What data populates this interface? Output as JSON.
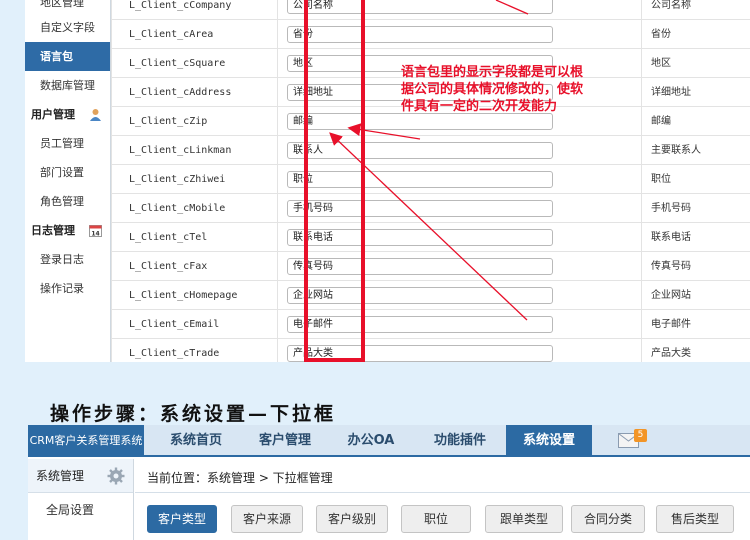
{
  "sidebar": {
    "cut_item": "地区管理",
    "items": [
      {
        "label": "自定义字段",
        "type": "item"
      },
      {
        "label": "语言包",
        "type": "active"
      },
      {
        "label": "数据库管理",
        "type": "item"
      },
      {
        "label": "用户管理",
        "type": "head"
      },
      {
        "label": "员工管理",
        "type": "item"
      },
      {
        "label": "部门设置",
        "type": "item"
      },
      {
        "label": "角色管理",
        "type": "item"
      },
      {
        "label": "日志管理",
        "type": "head"
      },
      {
        "label": "登录日志",
        "type": "item"
      },
      {
        "label": "操作记录",
        "type": "item"
      }
    ]
  },
  "fields": [
    {
      "name": "L_Client_cCompany",
      "value": "公司名称",
      "desc": "公司名称"
    },
    {
      "name": "L_Client_cArea",
      "value": "省份",
      "desc": "省份"
    },
    {
      "name": "L_Client_cSquare",
      "value": "地区",
      "desc": "地区"
    },
    {
      "name": "L_Client_cAddress",
      "value": "详细地址",
      "desc": "详细地址"
    },
    {
      "name": "L_Client_cZip",
      "value": "邮编",
      "desc": "邮编"
    },
    {
      "name": "L_Client_cLinkman",
      "value": "联系人",
      "desc": "主要联系人"
    },
    {
      "name": "L_Client_cZhiwei",
      "value": "职位",
      "desc": "职位"
    },
    {
      "name": "L_Client_cMobile",
      "value": "手机号码",
      "desc": "手机号码"
    },
    {
      "name": "L_Client_cTel",
      "value": "联系电话",
      "desc": "联系电话"
    },
    {
      "name": "L_Client_cFax",
      "value": "传真号码",
      "desc": "传真号码"
    },
    {
      "name": "L_Client_cHomepage",
      "value": "企业网站",
      "desc": "企业网站"
    },
    {
      "name": "L_Client_cEmail",
      "value": "电子邮件",
      "desc": "电子邮件"
    },
    {
      "name": "L_Client_cTrade",
      "value": "产品大类",
      "desc": "产品大类"
    }
  ],
  "annotation": {
    "note": "语言包里的显示字段都是可以根据公司的具体情况修改的，使软件具有一定的二次开发能力"
  },
  "step_title": "操作步骤：系统设置—下拉框",
  "app": {
    "brand": "CRM客户关系管理系统",
    "nav_tabs": [
      "系统首页",
      "客户管理",
      "办公OA",
      "功能插件",
      "系统设置"
    ],
    "active_tab": "系统设置",
    "mail_count": "5",
    "left_panel": {
      "title": "系统管理",
      "items": [
        "全局设置"
      ]
    },
    "breadcrumb": "当前位置：系统管理 > 下拉框管理",
    "dropdown_buttons": [
      "客户类型",
      "客户来源",
      "客户级别",
      "职位",
      "跟单类型",
      "合同分类",
      "售后类型"
    ],
    "active_button": "客户类型"
  },
  "colors": {
    "accent": "#2c6aa3",
    "highlight_red": "#e8102a",
    "badge": "#f29527"
  }
}
